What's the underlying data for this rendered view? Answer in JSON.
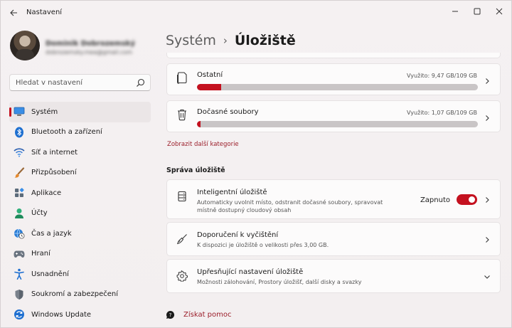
{
  "window": {
    "title": "Nastavení",
    "back_icon": "arrow-left-icon",
    "controls": [
      "minimize-icon",
      "maximize-icon",
      "close-icon"
    ]
  },
  "profile": {
    "name": "Dominik Dobrozemský",
    "email": "dobrozemsky.mea@gmail.com"
  },
  "search": {
    "placeholder": "Hledat v nastavení",
    "icon": "search-icon"
  },
  "sidebar": {
    "items": [
      {
        "label": "Systém",
        "icon": "monitor-icon",
        "active": true
      },
      {
        "label": "Bluetooth a zařízení",
        "icon": "bluetooth-icon"
      },
      {
        "label": "Síť a internet",
        "icon": "wifi-icon"
      },
      {
        "label": "Přizpůsobení",
        "icon": "brush-icon"
      },
      {
        "label": "Aplikace",
        "icon": "apps-icon"
      },
      {
        "label": "Účty",
        "icon": "person-icon"
      },
      {
        "label": "Čas a jazyk",
        "icon": "globe-clock-icon"
      },
      {
        "label": "Hraní",
        "icon": "gamepad-icon"
      },
      {
        "label": "Usnadnění",
        "icon": "accessibility-icon"
      },
      {
        "label": "Soukromí a zabezpečení",
        "icon": "shield-icon"
      },
      {
        "label": "Windows Update",
        "icon": "update-icon"
      }
    ]
  },
  "breadcrumb": {
    "parent": "Systém",
    "separator": "›",
    "current": "Úložiště"
  },
  "storage": {
    "categories": [
      {
        "title": "Ostatní",
        "used": "Využito: 9,47 GB/109 GB",
        "fraction": 0.087,
        "icon": "document-icon"
      },
      {
        "title": "Dočasné soubory",
        "used": "Využito: 1,07 GB/109 GB",
        "fraction": 0.0098,
        "icon": "trash-icon"
      }
    ],
    "more_link": "Zobrazit další kategorie"
  },
  "management": {
    "title": "Správa úložiště",
    "items": [
      {
        "title": "Inteligentní úložiště",
        "desc1": "Automaticky uvolnit místo, odstranit dočasné soubory, spravovat",
        "desc2": "místně dostupný cloudový obsah",
        "toggle_label": "Zapnuto",
        "toggle_on": true,
        "icon": "storage-drive-icon"
      },
      {
        "title": "Doporučení k vyčištění",
        "desc1": "K dispozici je úložiště o velikosti přes 3,00 GB.",
        "icon": "broom-icon"
      },
      {
        "title": "Upřesňující nastavení úložiště",
        "desc1": "Možnosti zálohování, Prostory úložišť, další disky a svazky",
        "icon": "gear-icon"
      }
    ]
  },
  "help": {
    "label": "Získat pomoc",
    "icon": "help-chat-icon"
  },
  "colors": {
    "accent": "#c4111f",
    "link": "#9b1e2a",
    "bar_track": "#c9c5c6"
  }
}
